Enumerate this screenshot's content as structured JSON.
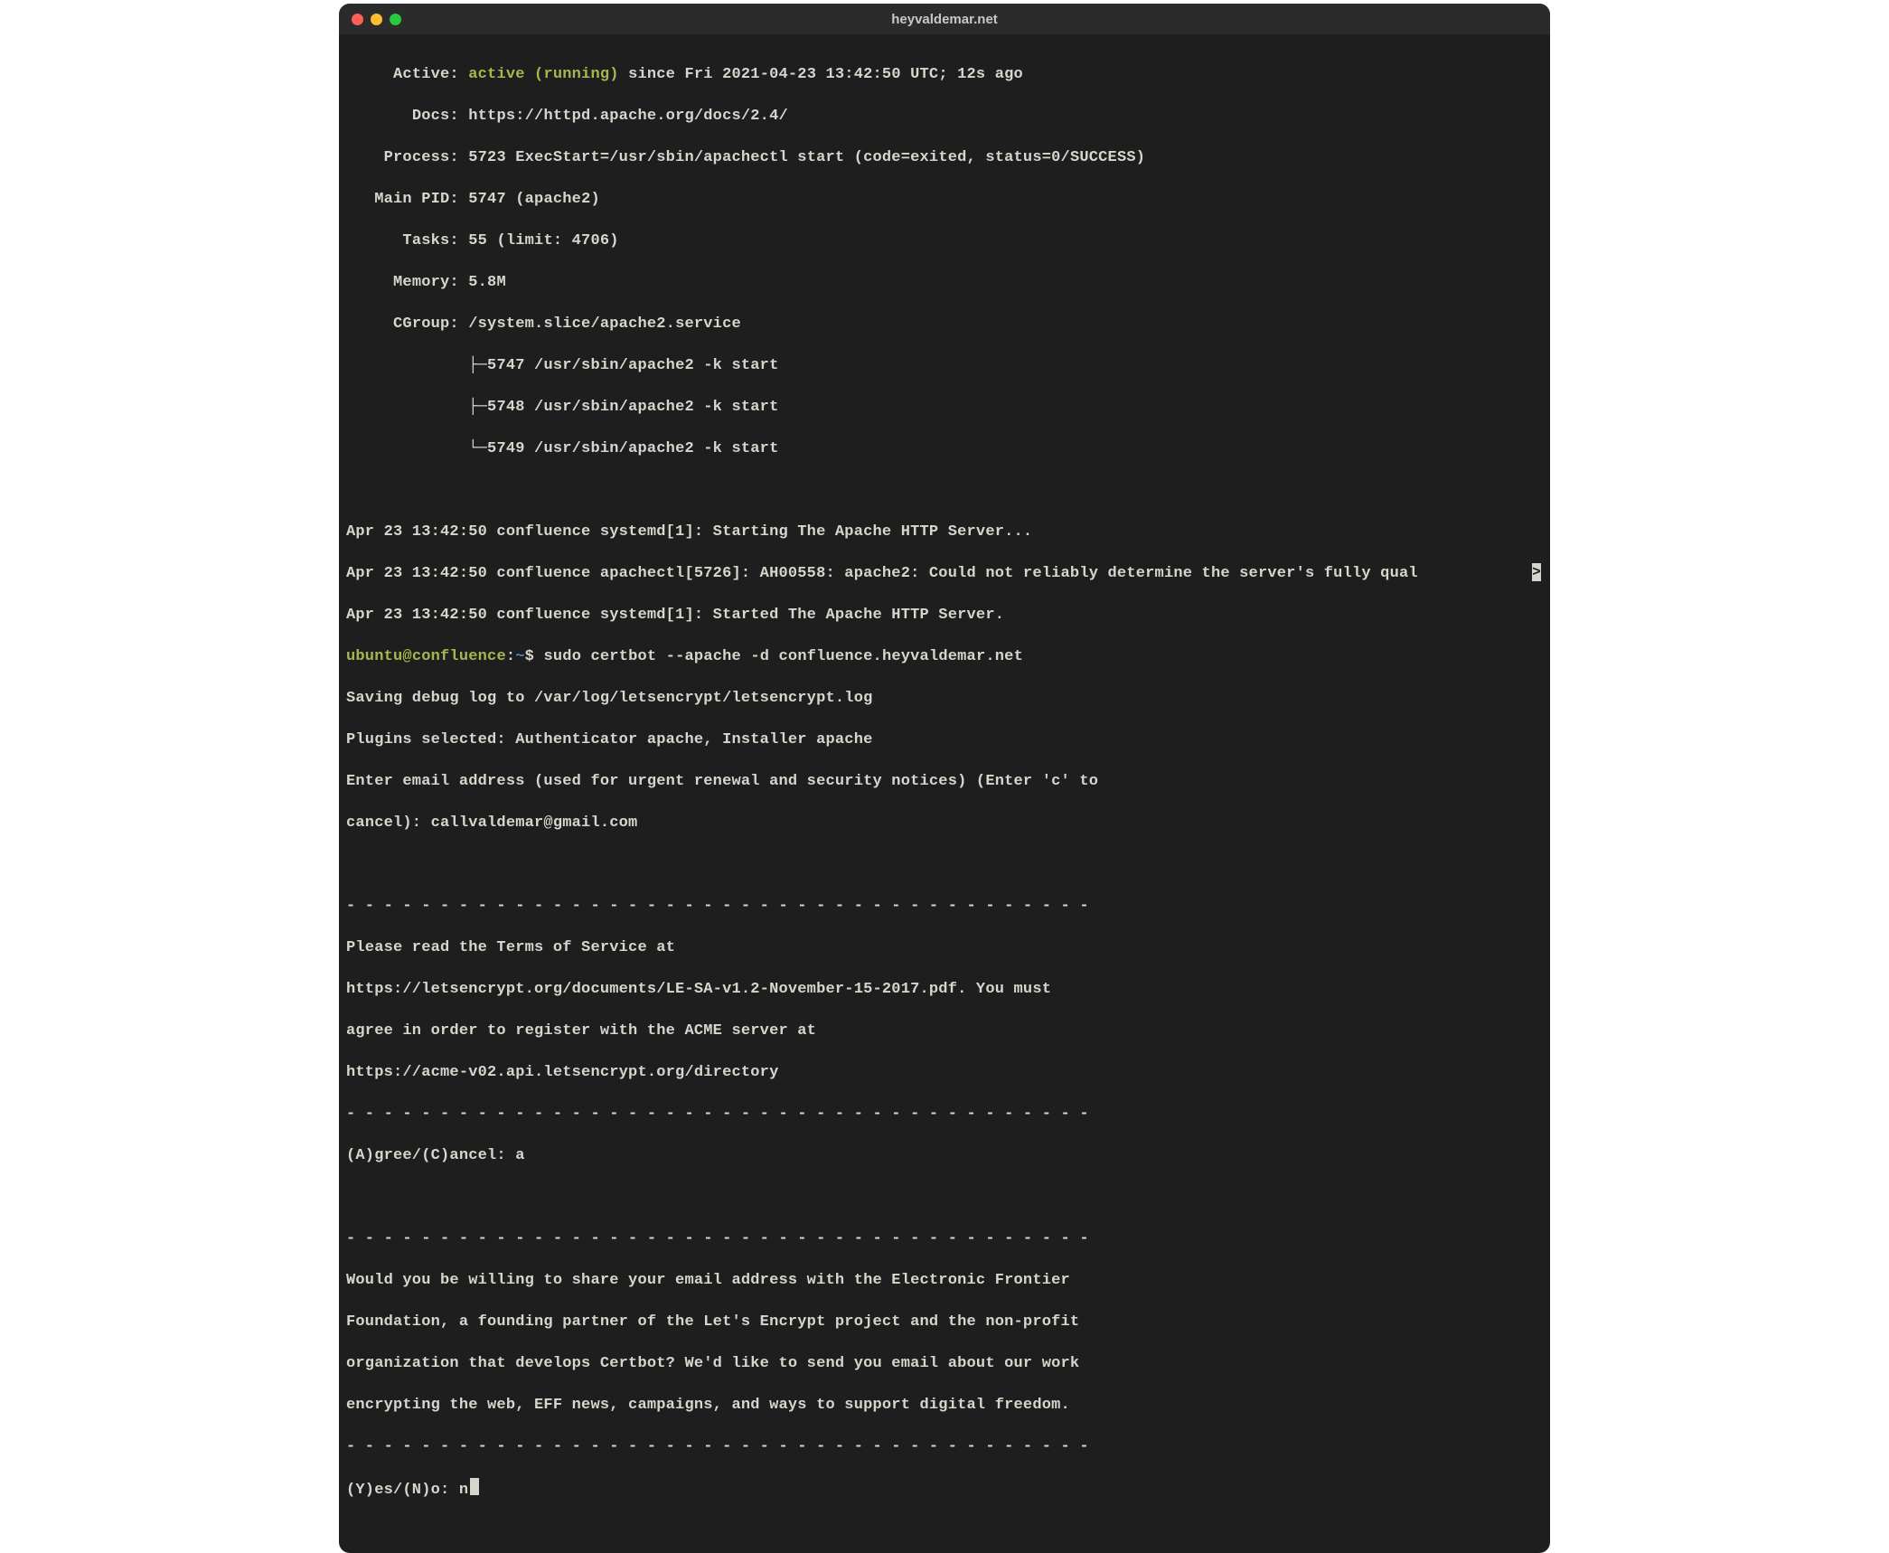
{
  "window": {
    "title": "heyvaldemar.net"
  },
  "status": {
    "active_label": "Active: ",
    "active_value": "active (running)",
    "active_since": " since Fri 2021-04-23 13:42:50 UTC; 12s ago",
    "docs_label": "Docs: ",
    "docs_value": "https://httpd.apache.org/docs/2.4/",
    "process_label": "Process: ",
    "process_value": "5723 ExecStart=/usr/sbin/apachectl start (code=exited, status=0/SUCCESS)",
    "mainpid_label": "Main PID: ",
    "mainpid_value": "5747 (apache2)",
    "tasks_label": "Tasks: ",
    "tasks_value": "55 (limit: 4706)",
    "memory_label": "Memory: ",
    "memory_value": "5.8M",
    "cgroup_label": "CGroup: ",
    "cgroup_value": "/system.slice/apache2.service",
    "cgroup_l1": "├─5747 /usr/sbin/apache2 -k start",
    "cgroup_l2": "├─5748 /usr/sbin/apache2 -k start",
    "cgroup_l3": "└─5749 /usr/sbin/apache2 -k start"
  },
  "logs": {
    "l1": "Apr 23 13:42:50 confluence systemd[1]: Starting The Apache HTTP Server...",
    "l2": "Apr 23 13:42:50 confluence apachectl[5726]: AH00558: apache2: Could not reliably determine the server's fully qual",
    "l3": "Apr 23 13:42:50 confluence systemd[1]: Started The Apache HTTP Server."
  },
  "prompt": {
    "user": "ubuntu",
    "at": "@",
    "host": "confluence",
    "colon": ":",
    "path": "~",
    "symbol": "$ ",
    "command": "sudo certbot --apache -d confluence.heyvaldemar.net"
  },
  "certbot": {
    "l1": "Saving debug log to /var/log/letsencrypt/letsencrypt.log",
    "l2": "Plugins selected: Authenticator apache, Installer apache",
    "l3": "Enter email address (used for urgent renewal and security notices) (Enter 'c' to",
    "l4": "cancel): callvaldemar@gmail.com",
    "blank": "",
    "dash": "- - - - - - - - - - - - - - - - - - - - - - - - - - - - - - - - - - - - - - - -",
    "t1": "Please read the Terms of Service at",
    "t2": "https://letsencrypt.org/documents/LE-SA-v1.2-November-15-2017.pdf. You must",
    "t3": "agree in order to register with the ACME server at",
    "t4": "https://acme-v02.api.letsencrypt.org/directory",
    "agree_prompt": "(A)gree/(C)ancel: a",
    "e1": "Would you be willing to share your email address with the Electronic Frontier",
    "e2": "Foundation, a founding partner of the Let's Encrypt project and the non-profit",
    "e3": "organization that develops Certbot? We'd like to send you email about our work",
    "e4": "encrypting the web, EFF news, campaigns, and ways to support digital freedom.",
    "yesno_prompt": "(Y)es/(N)o: n"
  },
  "scroll_indicator": ">"
}
